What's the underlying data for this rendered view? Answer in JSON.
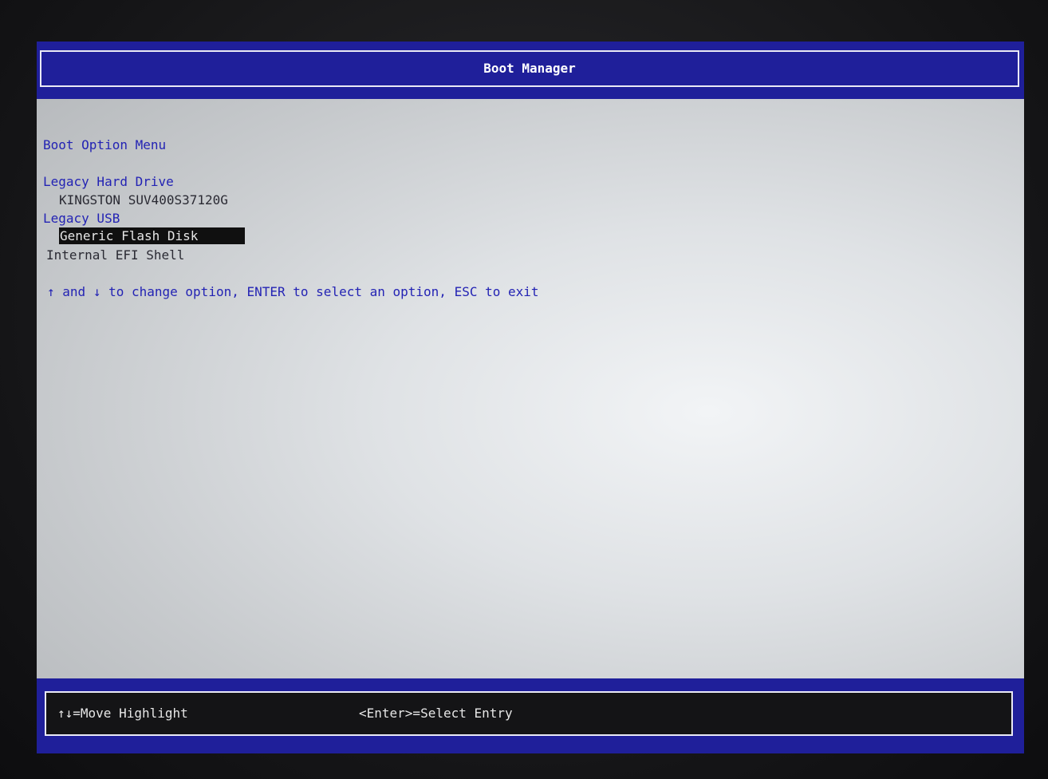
{
  "header": {
    "title": "Boot Manager"
  },
  "menu": {
    "title": "Boot Option Menu",
    "categories": [
      {
        "label": "Legacy Hard Drive",
        "items": [
          "KINGSTON SUV400S37120G"
        ]
      },
      {
        "label": "Legacy USB",
        "items": [
          "Generic Flash Disk"
        ]
      }
    ],
    "standalone_item": "Internal EFI Shell",
    "selected_item": "Generic Flash Disk"
  },
  "help": {
    "up_arrow": "↑",
    "and": " and ",
    "down_arrow": "↓",
    "rest": " to change option, ENTER to select an option, ESC to exit"
  },
  "footer": {
    "move_hint": "↑↓=Move Highlight",
    "select_hint": "<Enter>=Select Entry"
  },
  "colors": {
    "header_blue": "#1f1f9a",
    "text_blue": "#2323b4",
    "highlight": "#101010"
  }
}
